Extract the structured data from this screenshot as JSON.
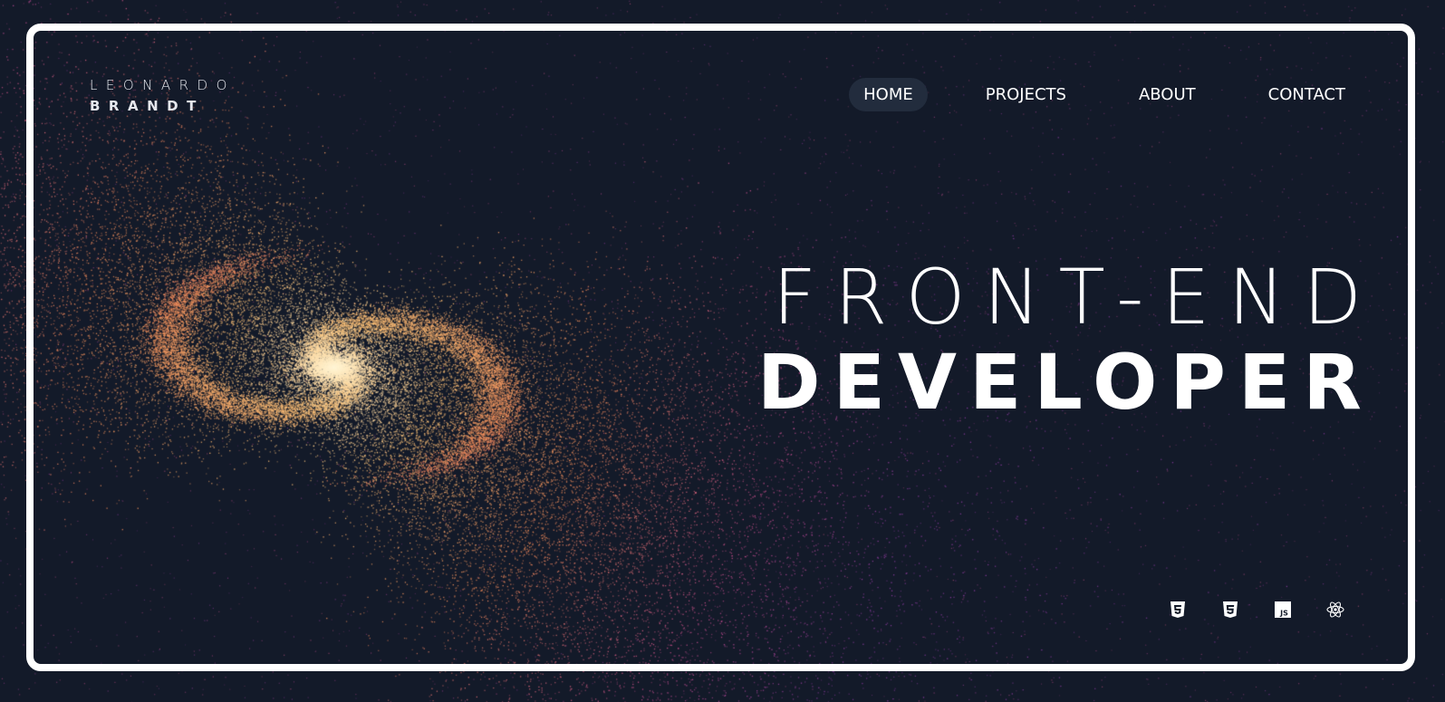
{
  "brand": {
    "first_name": "LEONARDO",
    "last_name": "BRANDT"
  },
  "nav": {
    "items": [
      {
        "label": "HOME",
        "active": true
      },
      {
        "label": "PROJECTS",
        "active": false
      },
      {
        "label": "ABOUT",
        "active": false
      },
      {
        "label": "CONTACT",
        "active": false
      }
    ]
  },
  "hero": {
    "line1": "FRONT-END",
    "line2": "DEVELOPER"
  },
  "tech_icons": [
    "html5-icon",
    "css3-icon",
    "javascript-icon",
    "react-icon"
  ],
  "colors": {
    "background": "#131a29",
    "frame": "#ffffff",
    "active_pill": "#222c3d",
    "particle_core": "#fff2c4",
    "particle_warm": "#f5a55b",
    "particle_cool": "#a8479a"
  }
}
